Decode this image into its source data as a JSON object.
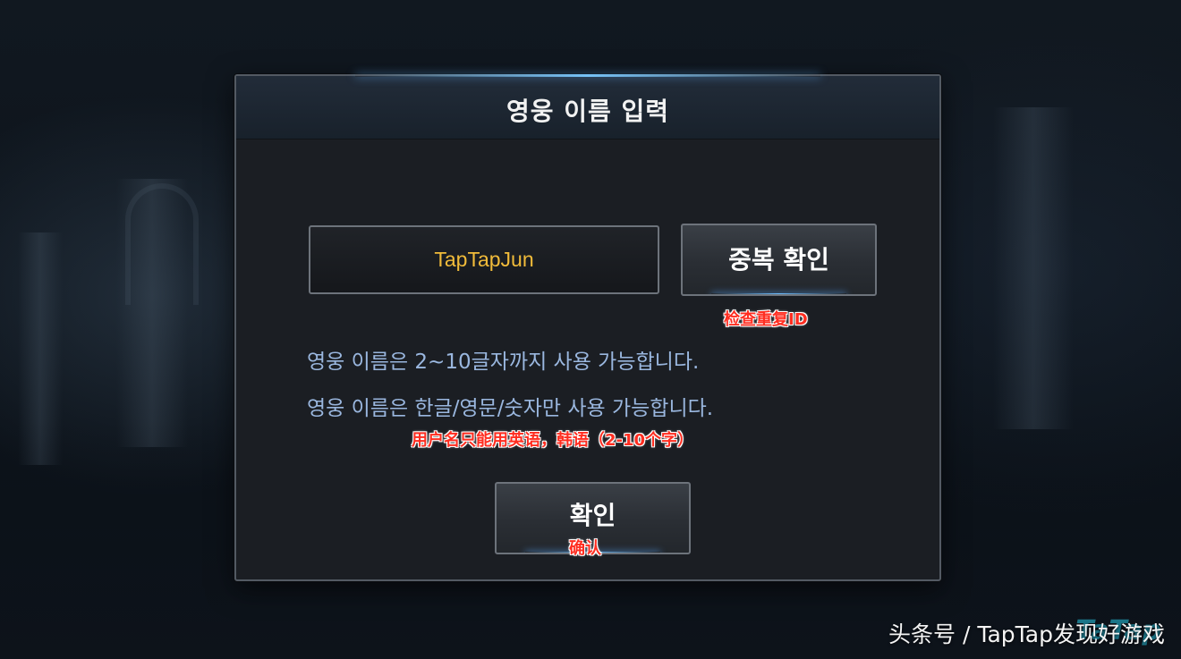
{
  "dialog": {
    "title": "영웅 이름 입력",
    "name_value": "TapTapJun",
    "duplicate_check_label": "중복 확인",
    "info_lines": [
      "영웅 이름은 2~10글자까지 사용 가능합니다.",
      "영웅 이름은 한글/영문/숫자만 사용 가능합니다."
    ],
    "confirm_label": "확인"
  },
  "annotations": {
    "duplicate_check_note": "检查重复ID",
    "rule_note": "用户名只能用英语，韩语（2-10个字）",
    "confirm_note": "确认"
  },
  "watermark": {
    "text": "头条号 / TapTap发现好游戏"
  },
  "colors": {
    "name_text": "#f1bb3a",
    "info_text": "#9ab7df",
    "annotation_red": "#ff2d20",
    "accent_glow": "#6ec0ff"
  }
}
